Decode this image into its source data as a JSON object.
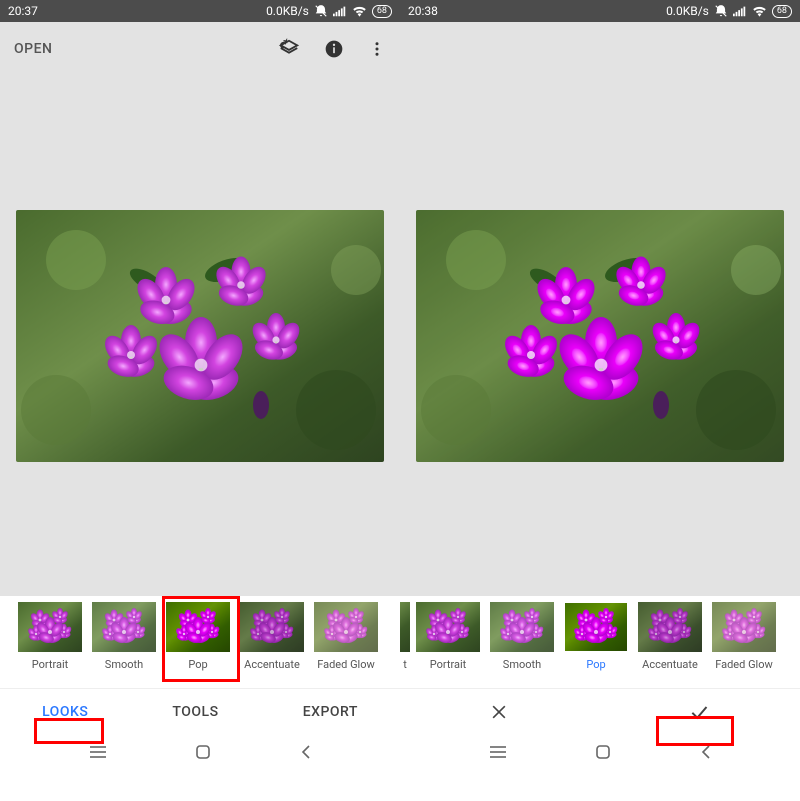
{
  "left": {
    "status": {
      "time": "20:37",
      "net": "0.0KB/s",
      "battery": "68"
    },
    "toolbar": {
      "open": "OPEN"
    },
    "filters": [
      {
        "label": "Portrait",
        "selected": false
      },
      {
        "label": "Smooth",
        "selected": false
      },
      {
        "label": "Pop",
        "selected": false,
        "boxed": true
      },
      {
        "label": "Accentuate",
        "selected": false
      },
      {
        "label": "Faded Glow",
        "selected": false
      }
    ],
    "tabs": {
      "looks": "LOOKS",
      "tools": "TOOLS",
      "export": "EXPORT",
      "active": "looks"
    }
  },
  "right": {
    "status": {
      "time": "20:38",
      "net": "0.0KB/s",
      "battery": "68"
    },
    "filters": [
      {
        "label": "t",
        "selected": false,
        "narrow": true
      },
      {
        "label": "Portrait",
        "selected": false
      },
      {
        "label": "Smooth",
        "selected": false
      },
      {
        "label": "Pop",
        "selected": true
      },
      {
        "label": "Accentuate",
        "selected": false
      },
      {
        "label": "Faded Glow",
        "selected": false
      }
    ]
  }
}
